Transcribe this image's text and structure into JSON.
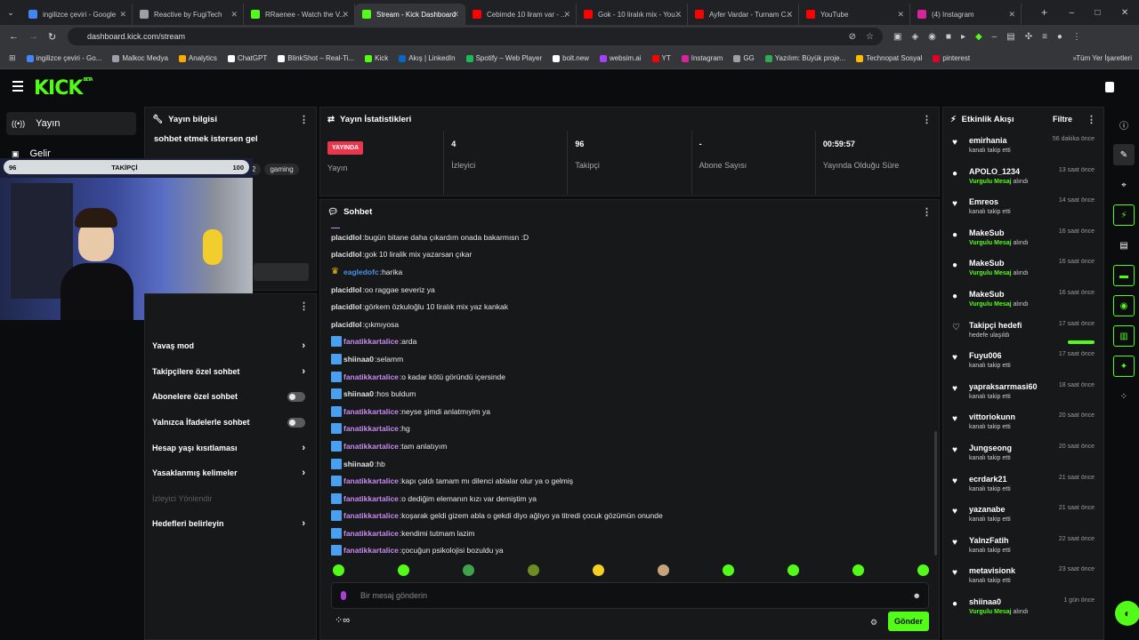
{
  "browser": {
    "tabs": [
      {
        "label": "ingilizce çeviri - Google",
        "color": "#4285f4"
      },
      {
        "label": "Reactive by FugiTech",
        "color": "#9aa0a6"
      },
      {
        "label": "RRaenee - Watch the V...",
        "color": "#53fc18"
      },
      {
        "label": "Stream - Kick Dashboard",
        "color": "#53fc18",
        "active": true
      },
      {
        "label": "Cebimde 10 liram var - ...",
        "color": "#ff0000"
      },
      {
        "label": "Gok - 10 liralık mix - You...",
        "color": "#ff0000"
      },
      {
        "label": "Ayfer Vardar - Turnam C...",
        "color": "#ff0000"
      },
      {
        "label": "YouTube",
        "color": "#ff0000"
      },
      {
        "label": "(4) Instagram",
        "color": "#d6249f"
      }
    ],
    "url": "dashboard.kick.com/stream",
    "bookmarks": [
      {
        "label": "ingilizce çeviri - Go...",
        "color": "#4285f4"
      },
      {
        "label": "Malkoc Medya",
        "color": "#9aa0a6"
      },
      {
        "label": "Analytics",
        "color": "#f9ab00"
      },
      {
        "label": "ChatGPT",
        "color": "#ffffff"
      },
      {
        "label": "BlinkShot – Real-Ti...",
        "color": "#ffffff"
      },
      {
        "label": "Kick",
        "color": "#53fc18"
      },
      {
        "label": "Akış | LinkedIn",
        "color": "#0a66c2"
      },
      {
        "label": "Spotify – Web Player",
        "color": "#1db954"
      },
      {
        "label": "bolt.new",
        "color": "#ffffff"
      },
      {
        "label": "websim.ai",
        "color": "#a142f4"
      },
      {
        "label": "YT",
        "color": "#ff0000"
      },
      {
        "label": "Instagram",
        "color": "#d6249f"
      },
      {
        "label": "GG",
        "color": "#9aa0a6"
      },
      {
        "label": "Yazılım: Büyük proje...",
        "color": "#34a853"
      },
      {
        "label": "Technopat Sosyal",
        "color": "#fbbc04"
      },
      {
        "label": "pinterest",
        "color": "#e60023"
      }
    ],
    "all_bookmarks": "Tüm Yer İşaretleri"
  },
  "kick": {
    "logo": "KICK",
    "logo_beta": "BETA",
    "sidebar": [
      {
        "label": "Yayın",
        "icon": "broadcast-icon"
      },
      {
        "label": "Gelir",
        "icon": "revenue-icon"
      }
    ],
    "stream_info": {
      "title": "Yayın bilgisi",
      "stream_title": "sohbet etmek istersen gel",
      "tags": [
        "türkish",
        "chill",
        "+2",
        "gaming"
      ]
    },
    "overlay": {
      "count": "96",
      "label": "TAKİPÇİ",
      "goal": "100"
    },
    "chat_settings": [
      {
        "label": "Yavaş mod",
        "type": "chev"
      },
      {
        "label": "Takipçilere özel sohbet",
        "type": "chev"
      },
      {
        "label": "Abonelere özel sohbet",
        "type": "toggle"
      },
      {
        "label": "Yalnızca İfadelerle sohbet",
        "type": "toggle"
      },
      {
        "label": "Hesap yaşı kısıtlaması",
        "type": "chev"
      },
      {
        "label": "Yasaklanmış kelimeler",
        "type": "chev"
      },
      {
        "label": "İzleyici Yönlendir",
        "type": "disabled"
      },
      {
        "label": "Hedefleri belirleyin",
        "type": "chev"
      }
    ],
    "stats": {
      "title": "Yayın İstatistikleri",
      "items": [
        {
          "value": "YAYINDA",
          "label": "Yayın"
        },
        {
          "value": "4",
          "label": "İzleyici"
        },
        {
          "value": "96",
          "label": "Takipçi"
        },
        {
          "value": "-",
          "label": "Abone Sayısı"
        },
        {
          "value": "00:59:57",
          "label": "Yayında Olduğu Süre"
        }
      ]
    },
    "chat": {
      "title": "Sohbet",
      "messages": [
        {
          "user": "placidlol",
          "text": "bugün bitane daha çıkardım onada bakarmısn :D",
          "color": "#e0e0e0",
          "badge": ""
        },
        {
          "user": "placidlol",
          "text": "gok 10 liralik mix yazarsan çıkar",
          "color": "#e0e0e0",
          "badge": ""
        },
        {
          "user": "eagledofc",
          "text": "harika",
          "color": "#4a90e2",
          "badge": "crown"
        },
        {
          "user": "placidlol",
          "text": "oo raggae severiz ya",
          "color": "#e0e0e0",
          "badge": ""
        },
        {
          "user": "placidlol",
          "text": "görkem özkuloğlu 10 liralık mix yaz kankak",
          "color": "#e0e0e0",
          "badge": ""
        },
        {
          "user": "placidlol",
          "text": "çıkmıyosa",
          "color": "#e0e0e0",
          "badge": ""
        },
        {
          "user": "fanatikkartalice",
          "text": "arda",
          "color": "#c98bf2",
          "badge": "sq"
        },
        {
          "user": "shiinaa0",
          "text": "selamm",
          "color": "#e0e0e0",
          "badge": "sq"
        },
        {
          "user": "fanatikkartalice",
          "text": "o kadar kötü göründü içersinde",
          "color": "#c98bf2",
          "badge": "sq"
        },
        {
          "user": "shiinaa0",
          "text": "hos buldum",
          "color": "#e0e0e0",
          "badge": "sq"
        },
        {
          "user": "fanatikkartalice",
          "text": "neyse şimdi anlatmıyim ya",
          "color": "#c98bf2",
          "badge": "sq"
        },
        {
          "user": "fanatikkartalice",
          "text": "hg",
          "color": "#c98bf2",
          "badge": "sq"
        },
        {
          "user": "fanatikkartalice",
          "text": "tam anlatıyım",
          "color": "#c98bf2",
          "badge": "sq"
        },
        {
          "user": "shiinaa0",
          "text": "hb",
          "color": "#e0e0e0",
          "badge": "sq"
        },
        {
          "user": "fanatikkartalice",
          "text": "kapı çaldı tamam mı dilenci ablalar olur ya o gelmiş",
          "color": "#c98bf2",
          "badge": "sq"
        },
        {
          "user": "fanatikkartalice",
          "text": "o dediğim elemanın kızı var demiştim ya",
          "color": "#c98bf2",
          "badge": "sq"
        },
        {
          "user": "fanatikkartalice",
          "text": "koşarak geldi gizem abla o gekdi diyo ağlıyo ya titredi çocuk gözümün onunde",
          "color": "#c98bf2",
          "badge": "sq"
        },
        {
          "user": "fanatikkartalice",
          "text": "kendimi tutmam lazim",
          "color": "#c98bf2",
          "badge": "sq"
        },
        {
          "user": "fanatikkartalice",
          "text": "çocuğun psikolojisi bozuldu ya",
          "color": "#c98bf2",
          "badge": "sq"
        }
      ],
      "emote_colors": [
        "#53fc18",
        "#53fc18",
        "#3fa34d",
        "#6b8e23",
        "#f5d020",
        "#c8a27a",
        "#53fc18",
        "#53fc18",
        "#53fc18",
        "#53fc18"
      ],
      "placeholder": "Bir mesaj gönderin",
      "send": "Gönder"
    },
    "activity": {
      "title": "Etkinlik Akışı",
      "filter": "Filtre",
      "items": [
        {
          "name": "emirhania",
          "sub": "kanalı takip etti",
          "time": "56 dakika önce",
          "icon": "♥"
        },
        {
          "name": "APOLO_1234",
          "sub_hl": "Vurgulu Mesaj",
          "sub": " alındı",
          "time": "13 saat önce",
          "icon": "●"
        },
        {
          "name": "Emreos",
          "sub": "kanalı takip etti",
          "time": "14 saat önce",
          "icon": "♥"
        },
        {
          "name": "MakeSub",
          "sub_hl": "Vurgulu Mesaj",
          "sub": " alındı",
          "time": "16 saat önce",
          "icon": "●"
        },
        {
          "name": "MakeSub",
          "sub_hl": "Vurgulu Mesaj",
          "sub": " alındı",
          "time": "16 saat önce",
          "icon": "●"
        },
        {
          "name": "MakeSub",
          "sub_hl": "Vurgulu Mesaj",
          "sub": " alındı",
          "time": "16 saat önce",
          "icon": "●"
        },
        {
          "name": "Takipçi hedefi",
          "sub": "hedefe ulaşıldı",
          "time": "17 saat önce",
          "icon": "♡"
        },
        {
          "name": "Fuyu006",
          "sub": "kanalı takip etti",
          "time": "17 saat önce",
          "icon": "♥"
        },
        {
          "name": "yapraksarrmasi60",
          "sub": "kanalı takip etti",
          "time": "18 saat önce",
          "icon": "♥"
        },
        {
          "name": "vittoriokunn",
          "sub": "kanalı takip etti",
          "time": "20 saat önce",
          "icon": "♥"
        },
        {
          "name": "Jungseong",
          "sub": "kanalı takip etti",
          "time": "20 saat önce",
          "icon": "♥"
        },
        {
          "name": "ecrdark21",
          "sub": "kanalı takip etti",
          "time": "21 saat önce",
          "icon": "♥"
        },
        {
          "name": "yazanabe",
          "sub": "kanalı takip etti",
          "time": "21 saat önce",
          "icon": "♥"
        },
        {
          "name": "YalnzFatih",
          "sub": "kanalı takip etti",
          "time": "22 saat önce",
          "icon": "♥"
        },
        {
          "name": "metavisionk",
          "sub": "kanalı takip etti",
          "time": "23 saat önce",
          "icon": "♥"
        },
        {
          "name": "shiinaa0",
          "sub_hl": "Vurgulu Mesaj",
          "sub": " alındı",
          "time": "1 gün önce",
          "icon": "●"
        }
      ]
    }
  }
}
